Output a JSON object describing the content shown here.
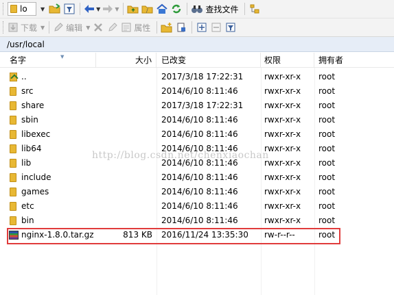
{
  "toolbar_top": {
    "path_combo_value": "lo",
    "find_file_label": "查找文件"
  },
  "toolbar_second": {
    "download_label": "下载",
    "edit_label": "编辑",
    "properties_label": "属性"
  },
  "path_bar": {
    "path": "/usr/local"
  },
  "columns": {
    "name": "名字",
    "size": "大小",
    "modified": "已改变",
    "permissions": "权限",
    "owner": "拥有者"
  },
  "rows": [
    {
      "name": "..",
      "size": "",
      "modified": "2017/3/18 17:22:31",
      "permissions": "rwxr-xr-x",
      "owner": "root",
      "icon": "parent-folder-icon"
    },
    {
      "name": "src",
      "size": "",
      "modified": "2014/6/10 8:11:46",
      "permissions": "rwxr-xr-x",
      "owner": "root",
      "icon": "folder-icon"
    },
    {
      "name": "share",
      "size": "",
      "modified": "2017/3/18 17:22:31",
      "permissions": "rwxr-xr-x",
      "owner": "root",
      "icon": "folder-icon"
    },
    {
      "name": "sbin",
      "size": "",
      "modified": "2014/6/10 8:11:46",
      "permissions": "rwxr-xr-x",
      "owner": "root",
      "icon": "folder-icon"
    },
    {
      "name": "libexec",
      "size": "",
      "modified": "2014/6/10 8:11:46",
      "permissions": "rwxr-xr-x",
      "owner": "root",
      "icon": "folder-icon"
    },
    {
      "name": "lib64",
      "size": "",
      "modified": "2014/6/10 8:11:46",
      "permissions": "rwxr-xr-x",
      "owner": "root",
      "icon": "folder-icon"
    },
    {
      "name": "lib",
      "size": "",
      "modified": "2014/6/10 8:11:46",
      "permissions": "rwxr-xr-x",
      "owner": "root",
      "icon": "folder-icon"
    },
    {
      "name": "include",
      "size": "",
      "modified": "2014/6/10 8:11:46",
      "permissions": "rwxr-xr-x",
      "owner": "root",
      "icon": "folder-icon"
    },
    {
      "name": "games",
      "size": "",
      "modified": "2014/6/10 8:11:46",
      "permissions": "rwxr-xr-x",
      "owner": "root",
      "icon": "folder-icon"
    },
    {
      "name": "etc",
      "size": "",
      "modified": "2014/6/10 8:11:46",
      "permissions": "rwxr-xr-x",
      "owner": "root",
      "icon": "folder-icon"
    },
    {
      "name": "bin",
      "size": "",
      "modified": "2014/6/10 8:11:46",
      "permissions": "rwxr-xr-x",
      "owner": "root",
      "icon": "folder-icon"
    },
    {
      "name": "nginx-1.8.0.tar.gz",
      "size": "813 KB",
      "modified": "2016/11/24 13:35:30",
      "permissions": "rw-r--r--",
      "owner": "root",
      "icon": "archive-icon"
    }
  ],
  "watermark": "http://blog.csdn.net/chenxiaochan",
  "colors": {
    "highlight_border": "#e03b3b",
    "path_bar_bg": "#e6edf7",
    "folder": "#e8b834"
  }
}
